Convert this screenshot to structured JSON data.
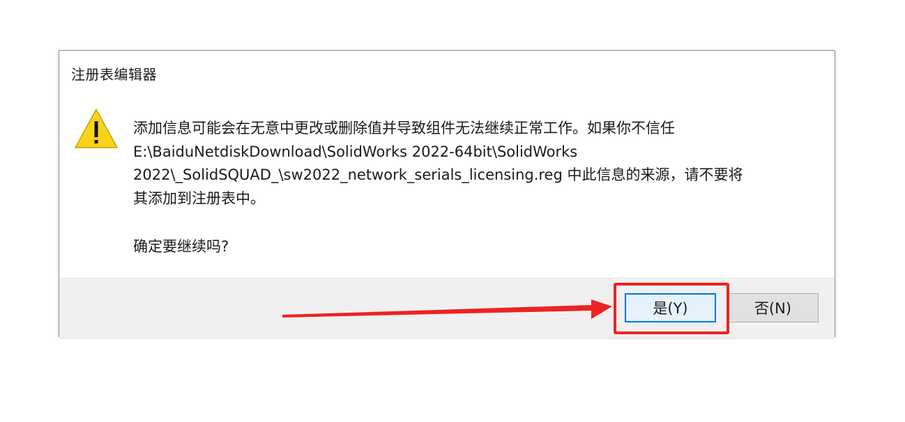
{
  "dialog": {
    "title": "注册表编辑器",
    "icon": "warning-icon",
    "message_lines": [
      "添加信息可能会在无意中更改或删除值并导致组件无法继续正常工作。如果你不信任",
      "E:\\BaiduNetdiskDownload\\SolidWorks 2022-64bit\\SolidWorks",
      "2022\\_SolidSQUAD_\\sw2022_network_serials_licensing.reg 中此信息的来源，请不要将",
      "其添加到注册表中。"
    ],
    "question": "确定要继续吗?",
    "buttons": {
      "yes_label": "是(Y)",
      "no_label": "否(N)"
    }
  },
  "annotation": {
    "highlight_color": "#ee2222",
    "arrow_color": "#ee2222"
  },
  "colors": {
    "accent": "#0078d7",
    "warning": "#f2c811"
  }
}
